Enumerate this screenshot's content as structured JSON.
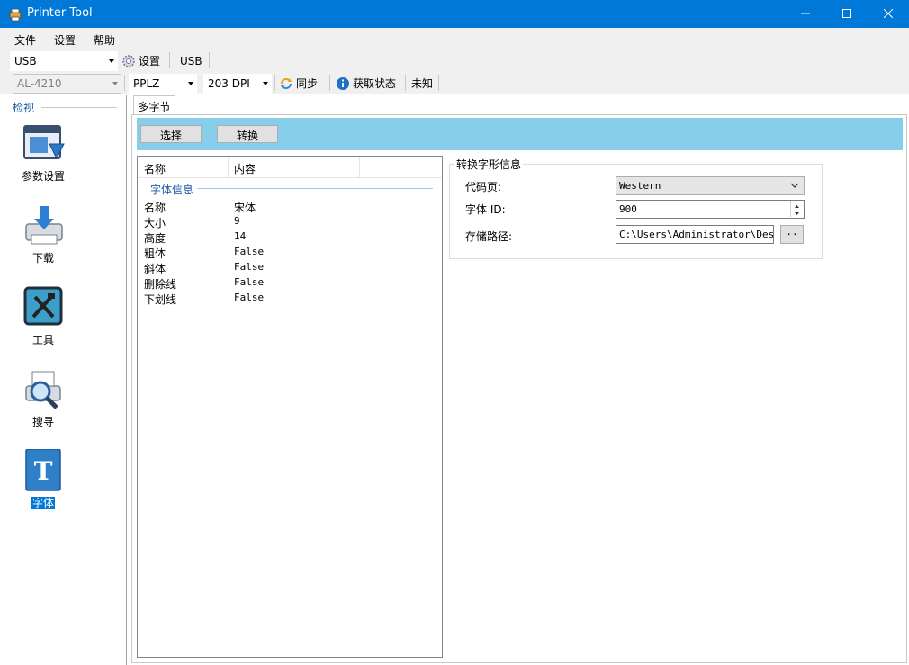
{
  "window": {
    "title": "Printer Tool",
    "controls": {
      "minimize": "minimize-icon",
      "maximize": "maximize-icon",
      "close": "close-icon"
    }
  },
  "menu": {
    "items": [
      "文件",
      "设置",
      "帮助"
    ]
  },
  "toolbar1": {
    "port_value": "USB",
    "settings_label": "设置",
    "port_status": "USB"
  },
  "toolbar2": {
    "model_value": "AL-4210",
    "language_value": "PPLZ",
    "dpi_value": "203 DPI",
    "sync_label": "同步",
    "get_status_label": "获取状态",
    "status_text": "未知"
  },
  "sidebar": {
    "group_label": "检视",
    "items": [
      {
        "label": "参数设置",
        "icon": "settings-window-icon"
      },
      {
        "label": "下载",
        "icon": "download-printer-icon"
      },
      {
        "label": "工具",
        "icon": "tools-icon"
      },
      {
        "label": "搜寻",
        "icon": "search-printer-icon"
      },
      {
        "label": "字体",
        "icon": "font-icon",
        "active": true
      }
    ]
  },
  "tabs": [
    {
      "label": "多字节",
      "active": true
    }
  ],
  "actions": {
    "select_label": "选择",
    "convert_label": "转换"
  },
  "font_list": {
    "columns": [
      "名称",
      "内容"
    ],
    "group": "字体信息",
    "rows": [
      {
        "name": "名称",
        "value": "宋体"
      },
      {
        "name": "大小",
        "value": "9"
      },
      {
        "name": "高度",
        "value": "14"
      },
      {
        "name": "粗体",
        "value": "False"
      },
      {
        "name": "斜体",
        "value": "False"
      },
      {
        "name": "删除线",
        "value": "False"
      },
      {
        "name": "下划线",
        "value": "False"
      }
    ]
  },
  "convert_info": {
    "title": "转换字形信息",
    "codepage_label": "代码页:",
    "codepage_value": "Western",
    "font_id_label": "字体 ID:",
    "font_id_value": "900",
    "path_label": "存储路径:",
    "path_value": "C:\\Users\\Administrator\\Deskto",
    "browse_label": ".."
  },
  "colors": {
    "titlebar": "#0078d7",
    "action_bar": "#87ceeb",
    "group_text": "#1e5aa8",
    "selection": "#0078d7"
  }
}
